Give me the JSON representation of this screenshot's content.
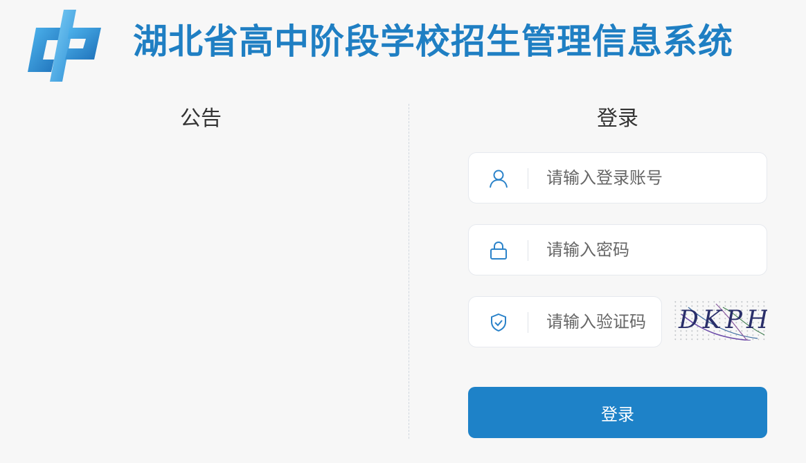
{
  "header": {
    "title": "湖北省高中阶段学校招生管理信息系统"
  },
  "notice": {
    "title": "公告"
  },
  "login": {
    "title": "登录",
    "username_placeholder": "请输入登录账号",
    "password_placeholder": "请输入密码",
    "captcha_placeholder": "请输入验证码",
    "captcha_text": "DKPH",
    "submit_label": "登录"
  },
  "icons": {
    "logo": "cp-logo",
    "username": "user-icon",
    "password": "lock-icon",
    "captcha": "shield-check-icon"
  },
  "colors": {
    "brand": "#1f7fc3",
    "button": "#1e82c8",
    "background": "#f7f7f7"
  }
}
